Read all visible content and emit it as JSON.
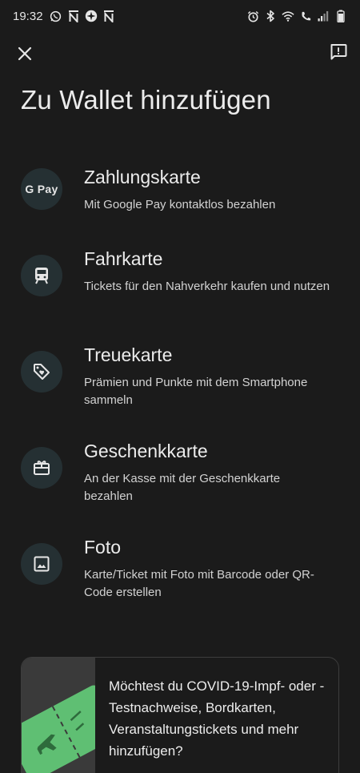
{
  "status": {
    "time": "19:32"
  },
  "page": {
    "title": "Zu Wallet hinzufügen"
  },
  "options": [
    {
      "id": "payment",
      "title": "Zahlungskarte",
      "description": "Mit Google Pay kontaktlos bezahlen",
      "icon": "google-pay-icon",
      "icon_text": "G Pay"
    },
    {
      "id": "transit",
      "title": "Fahrkarte",
      "description": "Tickets für den Nahverkehr kaufen und nutzen",
      "icon": "train-icon"
    },
    {
      "id": "loyalty",
      "title": "Treuekarte",
      "description": "Prämien und Punkte mit dem Smartphone sammeln",
      "icon": "tag-icon"
    },
    {
      "id": "gift",
      "title": "Geschenkkarte",
      "description": "An der Kasse mit der Geschenkkarte bezahlen",
      "icon": "gift-card-icon"
    },
    {
      "id": "photo",
      "title": "Foto",
      "description": "Karte/Ticket mit Foto mit Barcode oder QR-Code erstellen",
      "icon": "image-icon"
    }
  ],
  "promo": {
    "text": "Möchtest du COVID-19-Impf- oder -Testnachweise, Bordkarten, Veranstaltungstickets und mehr hinzufügen?"
  },
  "colors": {
    "background": "#1b1b1b",
    "icon_circle": "#253033",
    "promo_ticket": "#5fbf73"
  }
}
